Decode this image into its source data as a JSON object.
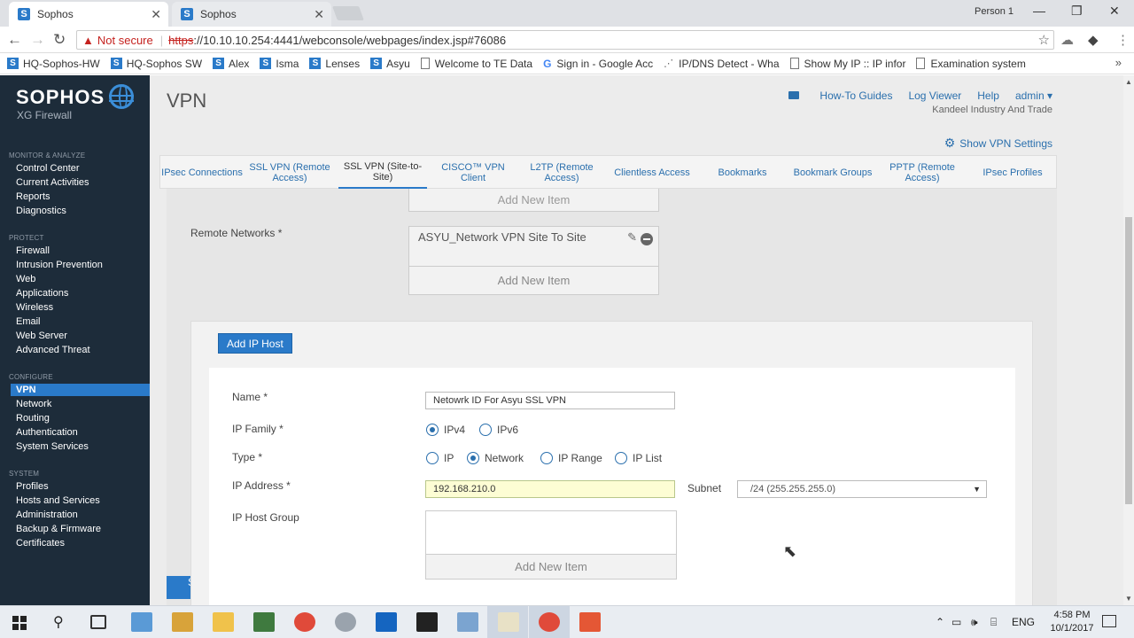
{
  "browser": {
    "tabs": [
      {
        "title": "Sophos",
        "active": true
      },
      {
        "title": "Sophos",
        "active": false
      }
    ],
    "person": "Person 1",
    "address": {
      "security": "Not secure",
      "scheme": "https",
      "url": "://10.10.10.254:4441/webconsole/webpages/index.jsp#76086"
    },
    "bookmarks": [
      {
        "label": "HQ-Sophos-HW",
        "icon": "sophos-icon"
      },
      {
        "label": "HQ-Sophos SW",
        "icon": "sophos-icon"
      },
      {
        "label": "Alex",
        "icon": "sophos-icon"
      },
      {
        "label": "Isma",
        "icon": "sophos-icon"
      },
      {
        "label": "Lenses",
        "icon": "sophos-icon"
      },
      {
        "label": "Asyu",
        "icon": "sophos-icon"
      },
      {
        "label": "Welcome to TE Data",
        "icon": "page-icon"
      },
      {
        "label": "Sign in - Google Acc",
        "icon": "google-icon"
      },
      {
        "label": "IP/DNS Detect - Wha",
        "icon": "ipdns-icon"
      },
      {
        "label": "Show My IP :: IP infor",
        "icon": "page-icon"
      },
      {
        "label": "Examination system",
        "icon": "page-icon"
      }
    ]
  },
  "sidebar": {
    "logo": "SOPHOS",
    "product": "XG Firewall",
    "sections": [
      {
        "title": "MONITOR & ANALYZE",
        "items": [
          "Control Center",
          "Current Activities",
          "Reports",
          "Diagnostics"
        ]
      },
      {
        "title": "PROTECT",
        "items": [
          "Firewall",
          "Intrusion Prevention",
          "Web",
          "Applications",
          "Wireless",
          "Email",
          "Web Server",
          "Advanced Threat"
        ]
      },
      {
        "title": "CONFIGURE",
        "items": [
          "VPN",
          "Network",
          "Routing",
          "Authentication",
          "System Services"
        ]
      },
      {
        "title": "SYSTEM",
        "items": [
          "Profiles",
          "Hosts and Services",
          "Administration",
          "Backup & Firmware",
          "Certificates"
        ]
      }
    ],
    "active_item": "VPN"
  },
  "header": {
    "title": "VPN",
    "links": [
      "How-To Guides",
      "Log Viewer",
      "Help",
      "admin ▾"
    ],
    "company": "Kandeel Industry And Trade",
    "show_settings": "Show VPN Settings"
  },
  "vpn_tabs": [
    "IPsec Connections",
    "SSL VPN (Remote Access)",
    "SSL VPN (Site-to-Site)",
    "CISCO™ VPN Client",
    "L2TP (Remote Access)",
    "Clientless Access",
    "Bookmarks",
    "Bookmark Groups",
    "PPTP (Remote Access)",
    "IPsec Profiles"
  ],
  "active_tab": "SSL VPN (Site-to-Site)",
  "form": {
    "add_new_item": "Add New Item",
    "remote_networks_label": "Remote Networks *",
    "remote_network_value": "ASYU_Network VPN Site To Site"
  },
  "modal": {
    "title_button": "Add IP Host",
    "name_label": "Name *",
    "name_value": "Netowrk ID For Asyu SSL VPN",
    "ip_family_label": "IP Family *",
    "ip_family_options": [
      "IPv4",
      "IPv6"
    ],
    "ip_family_selected": "IPv4",
    "type_label": "Type *",
    "type_options": [
      "IP",
      "Network",
      "IP Range",
      "IP List"
    ],
    "type_selected": "Network",
    "ip_address_label": "IP Address *",
    "ip_address_value": "192.168.210.0",
    "subnet_label": "Subnet",
    "subnet_value": "/24 (255.255.255.0)",
    "ip_host_group_label": "IP Host Group",
    "add_new_item": "Add New Item"
  },
  "taskbar": {
    "language": "ENG",
    "time": "4:58 PM",
    "date": "10/1/2017"
  },
  "colors": {
    "sidebar_bg": "#1d2c3a",
    "accent": "#2a7ac9",
    "link": "#2a6fad"
  }
}
